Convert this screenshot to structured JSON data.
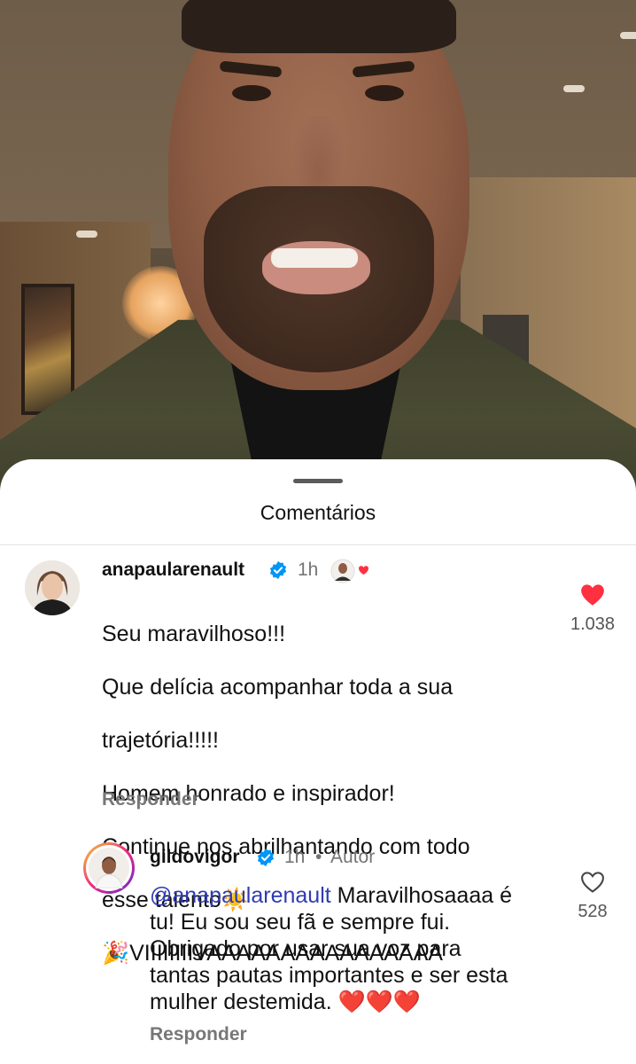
{
  "sheet": {
    "title": "Comentários"
  },
  "comments": [
    {
      "username": "anapaularenault",
      "verified": true,
      "time": "1h",
      "lines": [
        "Seu maravilhoso!!!",
        "Que delícia acompanhar toda a sua",
        "trajetória!!!!!",
        "Homem honrado e inspirador!",
        "Continue nos abrilhantando com todo",
        "esse talento☀️",
        "🎉VIIIIIIIIVAAAAAAAAAAAAAAAA"
      ],
      "reply_label": "Responder",
      "like_count": "1.038",
      "liked": true,
      "like_color": "#ff3040",
      "icon": "heart-filled-icon"
    },
    {
      "username": "gildovigor",
      "verified": true,
      "time": "1h",
      "author_tag": "Autor",
      "mention": "@anapaularenault",
      "text_after_mention": " Maravilhosaaaa é\ntu! Eu sou seu fã e sempre fui.\nObrigado por usar sua voz para\ntantas pautas importantes e ser esta\nmulher destemida. ❤️❤️❤️",
      "reply_label": "Responder",
      "like_count": "528",
      "liked": false,
      "icon": "heart-outline-icon"
    }
  ],
  "colors": {
    "verified_badge": "#0095f6",
    "mention": "#2e3bb3",
    "muted": "#757575"
  }
}
